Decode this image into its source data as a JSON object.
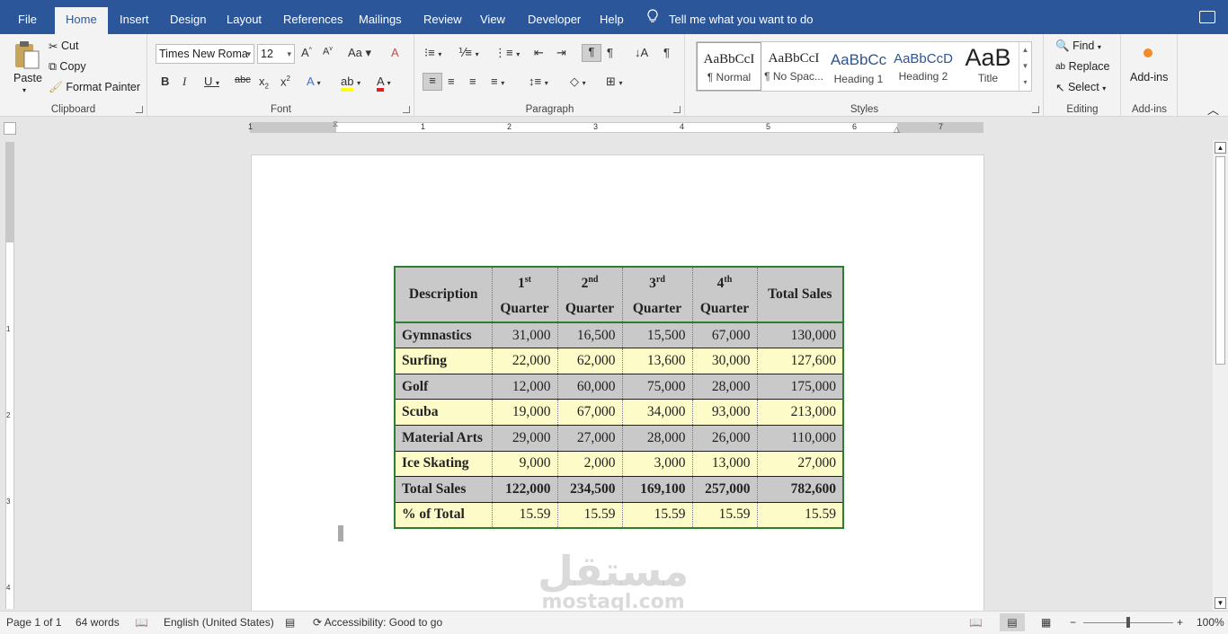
{
  "tabs": [
    "File",
    "Home",
    "Insert",
    "Design",
    "Layout",
    "References",
    "Mailings",
    "Review",
    "View",
    "Developer",
    "Help"
  ],
  "active_tab": "Home",
  "tell_me": "Tell me what you want to do",
  "clipboard": {
    "paste": "Paste",
    "cut": "Cut",
    "copy": "Copy",
    "format_painter": "Format Painter",
    "label": "Clipboard"
  },
  "font": {
    "name": "Times New Roma",
    "size": "12",
    "label": "Font"
  },
  "paragraph": {
    "label": "Paragraph"
  },
  "styles": {
    "label": "Styles",
    "items": [
      {
        "preview": "AaBbCcI",
        "name": "¶ Normal"
      },
      {
        "preview": "AaBbCcI",
        "name": "¶ No Spac..."
      },
      {
        "preview": "AaBbCc",
        "name": "Heading 1"
      },
      {
        "preview": "AaBbCcD",
        "name": "Heading 2"
      },
      {
        "preview": "AaB",
        "name": "Title"
      }
    ]
  },
  "editing": {
    "find": "Find",
    "replace": "Replace",
    "select": "Select",
    "label": "Editing"
  },
  "addins": {
    "button": "Add-ins",
    "label": "Add-ins"
  },
  "ruler": {
    "h_numbers": [
      "1",
      "1",
      "2",
      "3",
      "4",
      "5",
      "6",
      "7"
    ],
    "v_numbers": [
      "1",
      "1",
      "2",
      "3",
      "4"
    ]
  },
  "table": {
    "headers": [
      {
        "text": "Description"
      },
      {
        "num": "1",
        "sup": "st",
        "word": "Quarter"
      },
      {
        "num": "2",
        "sup": "nd",
        "word": "Quarter"
      },
      {
        "num": "3",
        "sup": "rd",
        "word": "Quarter"
      },
      {
        "num": "4",
        "sup": "th",
        "word": "Quarter"
      },
      {
        "text": "Total Sales"
      }
    ],
    "rows": [
      [
        "Gymnastics",
        "31,000",
        "16,500",
        "15,500",
        "67,000",
        "130,000"
      ],
      [
        "Surfing",
        "22,000",
        "62,000",
        "13,600",
        "30,000",
        "127,600"
      ],
      [
        "Golf",
        "12,000",
        "60,000",
        "75,000",
        "28,000",
        "175,000"
      ],
      [
        "Scuba",
        "19,000",
        "67,000",
        "34,000",
        "93,000",
        "213,000"
      ],
      [
        "Material Arts",
        "29,000",
        "27,000",
        "28,000",
        "26,000",
        "110,000"
      ],
      [
        "Ice Skating",
        "9,000",
        "2,000",
        "3,000",
        "13,000",
        "27,000"
      ],
      [
        "Total Sales",
        "122,000",
        "234,500",
        "169,100",
        "257,000",
        "782,600"
      ],
      [
        "% of Total",
        "15.59",
        "15.59",
        "15.59",
        "15.59",
        "15.59"
      ]
    ]
  },
  "watermark": {
    "arabic": "مستقل",
    "latin": "mostaql.com"
  },
  "status": {
    "page": "Page 1 of 1",
    "words": "64 words",
    "language": "English (United States)",
    "accessibility": "Accessibility: Good to go",
    "zoom": "100%"
  },
  "colors": {
    "title_bar": "#2b579a",
    "table_border": "#2e7d32",
    "row_gray": "#c9c9c9",
    "row_yellow": "#fdfbc8"
  }
}
